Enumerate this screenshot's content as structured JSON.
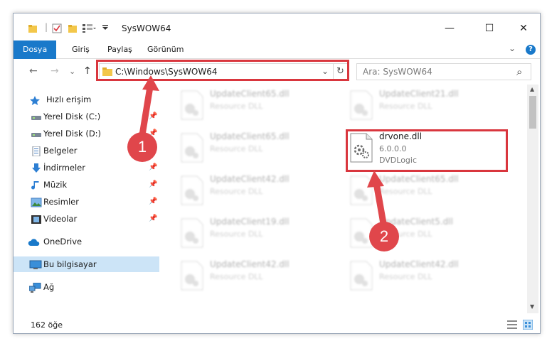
{
  "window": {
    "title": "SysWOW64",
    "controls": {
      "minimize": "—",
      "maximize": "☐",
      "close": "✕"
    }
  },
  "ribbon": {
    "tabs": [
      "Dosya",
      "Giriş",
      "Paylaş",
      "Görünüm"
    ],
    "expand": "⌄",
    "help": "?"
  },
  "nav": {
    "back": "←",
    "forward": "→",
    "recent": "⌄",
    "up": "↑",
    "address": "C:\\Windows\\SysWOW64",
    "address_dropdown": "⌄",
    "refresh": "↻",
    "search_placeholder": "Ara: SysWOW64",
    "search_icon": "⌕"
  },
  "sidebar": {
    "items": [
      {
        "label": "Hızlı erişim",
        "icon": "star-icon",
        "pinned": false
      },
      {
        "label": "Yerel Disk (C:)",
        "icon": "drive-icon",
        "pinned": true
      },
      {
        "label": "Yerel Disk (D:)",
        "icon": "drive-icon",
        "pinned": true
      },
      {
        "label": "Belgeler",
        "icon": "document-icon",
        "pinned": true
      },
      {
        "label": "İndirmeler",
        "icon": "download-icon",
        "pinned": true
      },
      {
        "label": "Müzik",
        "icon": "music-icon",
        "pinned": true
      },
      {
        "label": "Resimler",
        "icon": "picture-icon",
        "pinned": true
      },
      {
        "label": "Videolar",
        "icon": "video-icon",
        "pinned": true
      },
      {
        "label": "OneDrive",
        "icon": "cloud-icon",
        "pinned": false
      },
      {
        "label": "Bu bilgisayar",
        "icon": "computer-icon",
        "pinned": false
      },
      {
        "label": "Ağ",
        "icon": "network-icon",
        "pinned": false
      }
    ],
    "pin_glyph": "📌"
  },
  "files": {
    "left": [
      {
        "name": "UpdateClient65.dll",
        "type": "Resource DLL"
      },
      {
        "name": "UpdateClient65.dll",
        "type": "Resource DLL"
      },
      {
        "name": "UpdateClient42.dll",
        "type": "Resource DLL"
      },
      {
        "name": "UpdateClient19.dll",
        "type": "Resource DLL"
      },
      {
        "name": "UpdateClient42.dll",
        "type": "Resource DLL"
      }
    ],
    "right": [
      {
        "name": "UpdateClient21.dll",
        "type": "Resource DLL"
      },
      {
        "name": "UpdateClient65.dll",
        "type": "Resource DLL"
      },
      {
        "name": "UpdateClient5.dll",
        "type": "Resource DLL"
      },
      {
        "name": "UpdateClient42.dll",
        "type": "Resource DLL"
      }
    ],
    "highlighted": {
      "name": "drvone.dll",
      "version": "6.0.0.0",
      "company": "DVDLogic"
    }
  },
  "status": {
    "count": "162 öğe"
  },
  "annotations": {
    "step1": "1",
    "step2": "2",
    "accent": "#d9363e"
  },
  "colors": {
    "ribbon_active": "#1979ca",
    "selected": "#cce4f7"
  }
}
